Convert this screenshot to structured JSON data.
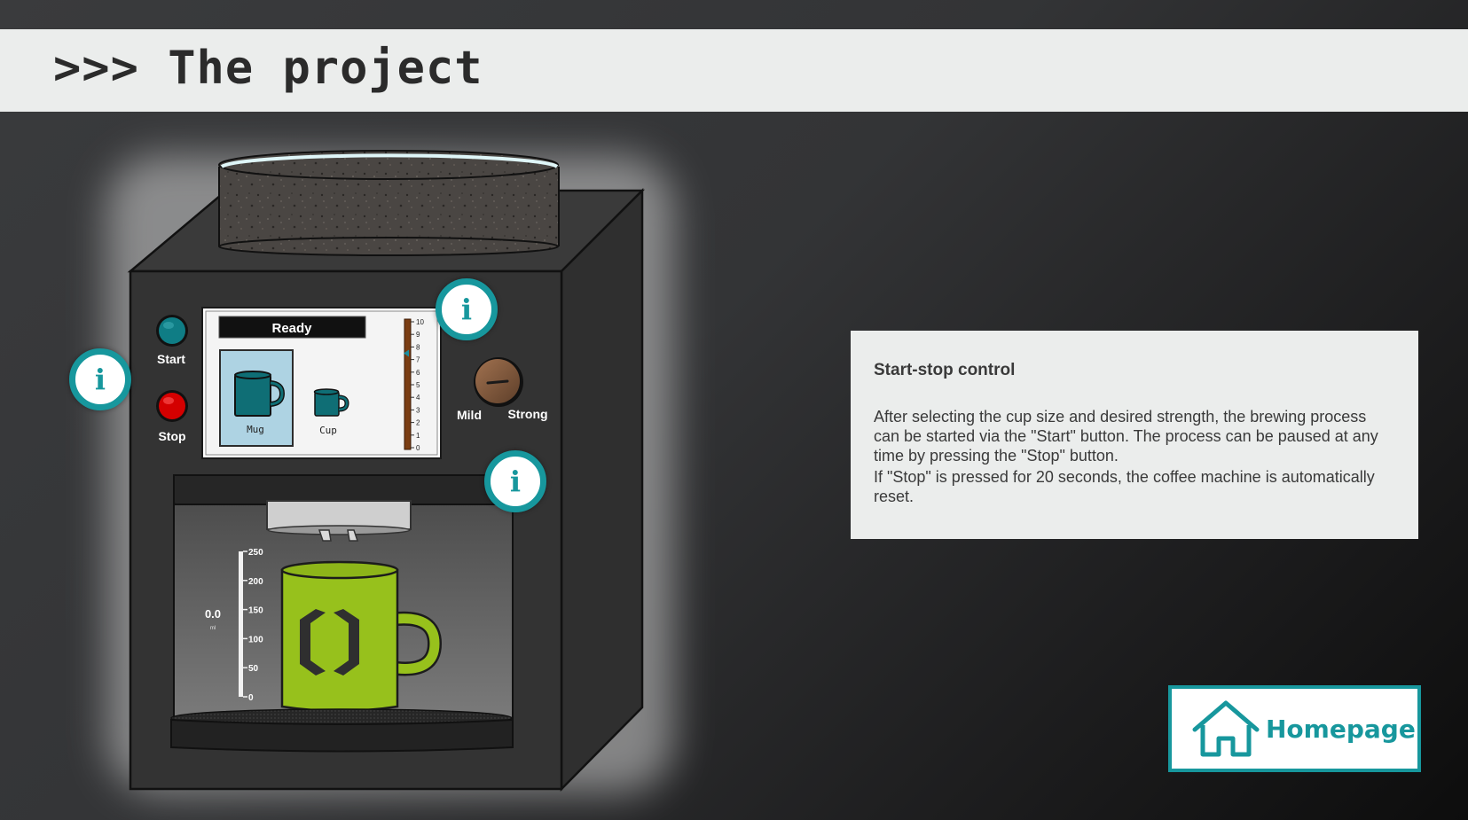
{
  "header": {
    "title": ">>> The project"
  },
  "machine": {
    "controls": {
      "start_label": "Start",
      "stop_label": "Stop",
      "mild_label": "Mild",
      "strong_label": "Strong"
    },
    "display": {
      "status": "Ready",
      "cup_options": [
        {
          "label": "Mug",
          "selected": true
        },
        {
          "label": "Cup",
          "selected": false
        }
      ],
      "strength_ticks": [
        "10",
        "9",
        "8",
        "7",
        "6",
        "5",
        "4",
        "3",
        "2",
        "1",
        "0"
      ],
      "strength_value": 7.5
    },
    "fill_gauge": {
      "ticks": [
        "250",
        "200",
        "150",
        "100",
        "50",
        "0"
      ],
      "value": "0.0",
      "unit": "ml"
    }
  },
  "info_icon_glyph": "i",
  "info_panel": {
    "title": "Start-stop control",
    "paragraph1": "After selecting the cup size and desired strength, the brewing process can be started via the \"Start\" button. The process can be paused at any time by pressing the \"Stop\" button.",
    "paragraph2": "If \"Stop\" is pressed for 20 seconds, the coffee machine is automatically reset."
  },
  "homepage_button": {
    "label": "Homepage",
    "icon": "house-icon"
  },
  "colors": {
    "accent": "#17979d",
    "header_bg": "#ebedec",
    "start_button": "#0f7d85",
    "stop_button": "#d40000",
    "mug_green": "#97c11c",
    "cup_teal": "#0f6e75"
  }
}
